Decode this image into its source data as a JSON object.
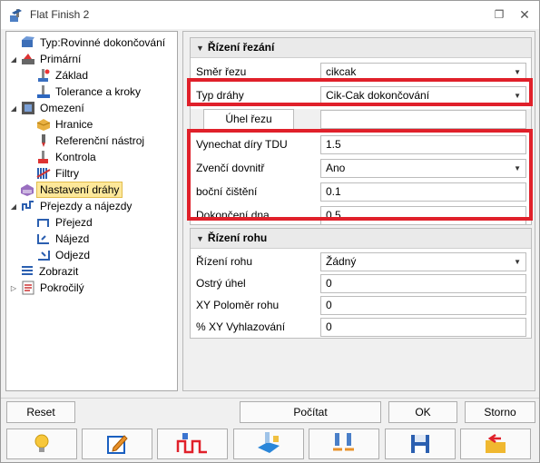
{
  "window": {
    "title": "Flat Finish 2",
    "restore_glyph": "❐",
    "close_glyph": "✕"
  },
  "tree": {
    "items": [
      {
        "label": "Typ:Rovinné dokončování",
        "icon": "type-icon",
        "arrow": ""
      },
      {
        "label": "Primární",
        "icon": "primary-icon",
        "arrow": "◢"
      },
      {
        "label": "Základ",
        "icon": "base-icon",
        "arrow": ""
      },
      {
        "label": "Tolerance a kroky",
        "icon": "tolerance-icon",
        "arrow": ""
      },
      {
        "label": "Omezení",
        "icon": "limits-icon",
        "arrow": "◢"
      },
      {
        "label": "Hranice",
        "icon": "boundary-icon",
        "arrow": ""
      },
      {
        "label": "Referenční nástroj",
        "icon": "reference-tool-icon",
        "arrow": ""
      },
      {
        "label": "Kontrola",
        "icon": "check-icon",
        "arrow": ""
      },
      {
        "label": "Filtry",
        "icon": "filters-icon",
        "arrow": ""
      },
      {
        "label": "Nastavení dráhy",
        "icon": "path-settings-icon",
        "arrow": "",
        "selected": true
      },
      {
        "label": "Přejezdy a nájezdy",
        "icon": "links-icon",
        "arrow": "◢"
      },
      {
        "label": "Přejezd",
        "icon": "link-icon",
        "arrow": ""
      },
      {
        "label": "Nájezd",
        "icon": "lead-in-icon",
        "arrow": ""
      },
      {
        "label": "Odjezd",
        "icon": "lead-out-icon",
        "arrow": ""
      },
      {
        "label": "Zobrazit",
        "icon": "display-icon",
        "arrow": ""
      },
      {
        "label": "Pokročilý",
        "icon": "advanced-icon",
        "arrow": "▷"
      }
    ]
  },
  "cutting": {
    "title": "Řízení řezání",
    "rows": [
      {
        "label": "Směr řezu",
        "value": "cikcak",
        "dropdown": true
      },
      {
        "label": "Typ dráhy",
        "value": "Cik-Cak dokončování",
        "dropdown": true
      },
      {
        "label": "Úhel řezu",
        "value": ""
      },
      {
        "label": "Vynechat díry TDU",
        "value": "1.5"
      },
      {
        "label": "Zvenčí dovnitř",
        "value": "Ano",
        "dropdown": true
      },
      {
        "label": "boční čištění",
        "value": "0.1"
      },
      {
        "label": "Dokončení dna",
        "value": "0.5"
      }
    ]
  },
  "corner": {
    "title": "Řízení rohu",
    "rows": [
      {
        "label": "Řízení rohu",
        "value": "Žádný",
        "dropdown": true
      },
      {
        "label": "Ostrý úhel",
        "value": "0"
      },
      {
        "label": "XY Poloměr rohu",
        "value": "0"
      },
      {
        "label": "% XY Vyhlazování",
        "value": "0"
      }
    ]
  },
  "buttons": {
    "reset": "Reset",
    "compute": "Počítat",
    "ok": "OK",
    "cancel": "Storno"
  },
  "toolbar_icons": [
    "bulb-icon",
    "edit-icon",
    "toolpath-icon",
    "calc-icon",
    "compare-icon",
    "save-icon",
    "load-icon"
  ],
  "colors": {
    "highlight": "#e0202a",
    "selection": "#fde89a"
  }
}
